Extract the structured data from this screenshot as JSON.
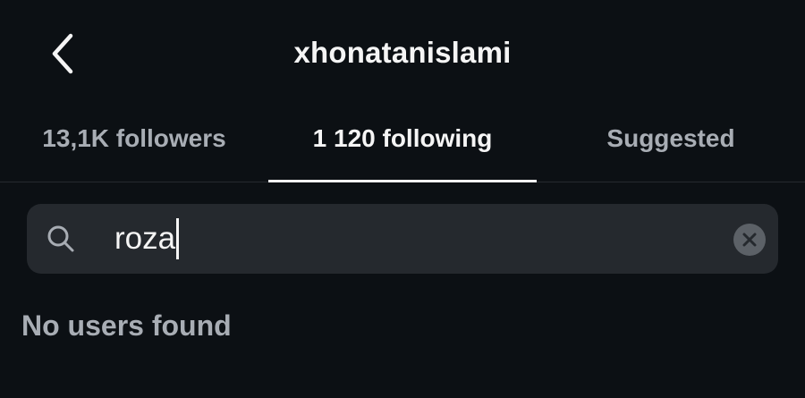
{
  "header": {
    "title": "xhonatanislami",
    "back_icon": "chevron-left-icon"
  },
  "tabs": [
    {
      "label": "13,1K followers",
      "active": false
    },
    {
      "label": "1 120 following",
      "active": true
    },
    {
      "label": "Suggested",
      "active": false
    }
  ],
  "search": {
    "value": "roza",
    "icon": "search-icon",
    "clear_icon": "close-icon"
  },
  "results": {
    "empty_message": "No users found"
  },
  "colors": {
    "background": "#0c1014",
    "text_primary": "#f5f5f5",
    "text_secondary": "#a8adb4",
    "search_bg": "#25292e"
  }
}
